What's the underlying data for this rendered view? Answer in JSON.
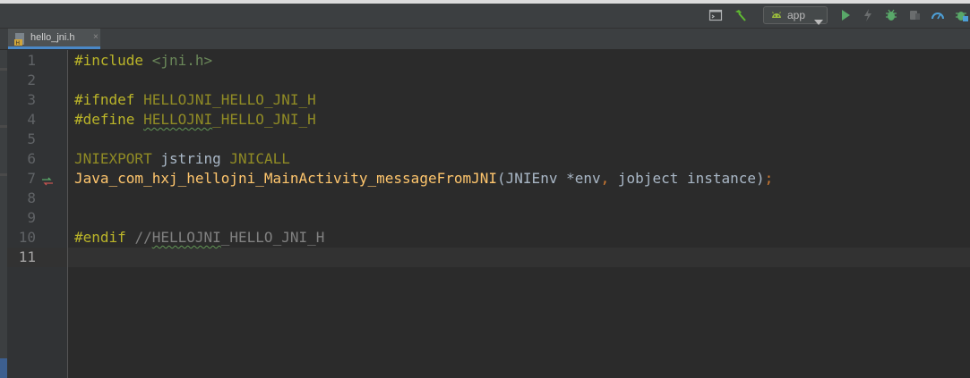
{
  "toolbar": {
    "run_config_label": "app",
    "icons": [
      "terminal-icon",
      "build-hammer-icon",
      "android-icon",
      "dropdown-arrow-icon",
      "run-icon",
      "apply-changes-icon",
      "debug-icon",
      "attach-debugger-icon",
      "profiler-icon",
      "android-debug-icon"
    ]
  },
  "tab": {
    "filename": "hello_jni.h",
    "close": "×"
  },
  "editor": {
    "line_numbers": [
      "1",
      "2",
      "3",
      "4",
      "5",
      "6",
      "7",
      "8",
      "9",
      "10",
      "11"
    ],
    "current_line": "11",
    "code": {
      "l1_directive": "#include",
      "l1_header": "<jni.h>",
      "l3_directive": "#ifndef",
      "l3_macro": "HELLOJNI_HELLO_JNI_H",
      "l4_directive": "#define",
      "l4_macro_a": "HELLOJNI",
      "l4_macro_b": "_HELLO_JNI_H",
      "l6_export": "JNIEXPORT",
      "l6_type": "jstring",
      "l6_call": "JNICALL",
      "l7_function": "Java_com_hxj_hellojni_MainActivity_messageFromJNI",
      "l7_paren_open": "(",
      "l7_param1": "JNIEnv *env",
      "l7_comma": ",",
      "l7_param2": "jobject instance",
      "l7_paren_close": ")",
      "l7_semicolon": ";",
      "l10_directive": "#endif",
      "l10_comment_slashes": "//",
      "l10_comment_a": "HELLOJNI",
      "l10_comment_b": "_HELLO_JNI_H"
    }
  },
  "colors": {
    "background": "#2b2b2b",
    "preprocessor": "#bbb529",
    "function": "#ffc66d",
    "string": "#6a8759",
    "comment": "#808080",
    "punctuation": "#cc7832"
  }
}
